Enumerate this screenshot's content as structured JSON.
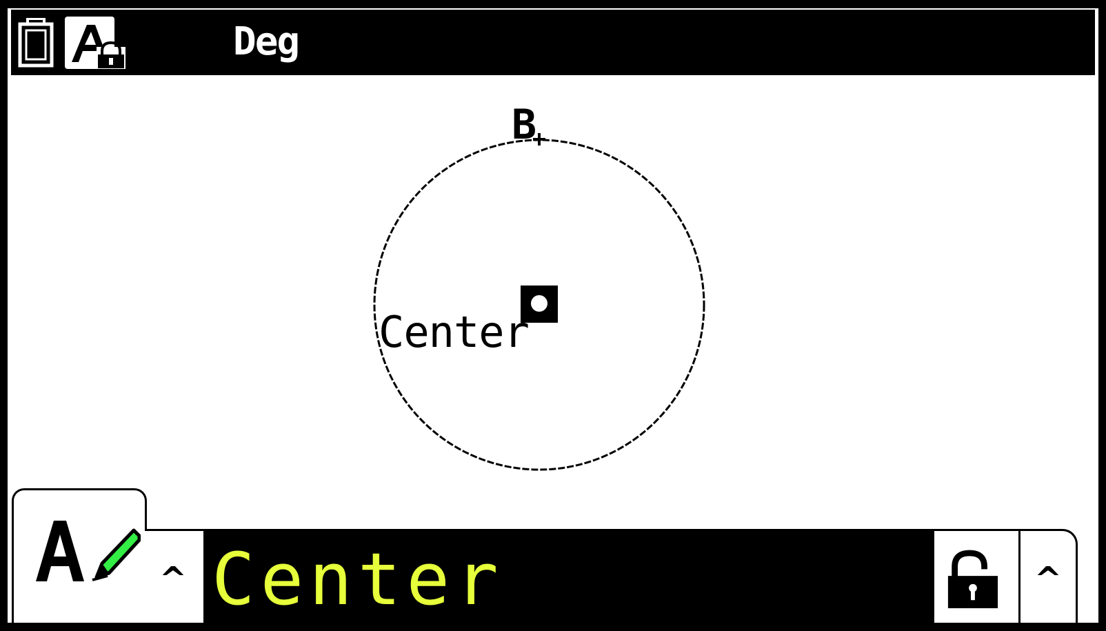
{
  "status_bar": {
    "battery_icon": "battery-icon",
    "input_mode_icon": "alpha-lock-icon",
    "angle_mode": "Deg"
  },
  "geometry": {
    "circle_label": "B",
    "center_label": "Center",
    "center_marker": "selected-point-marker"
  },
  "label_editor": {
    "mode_icon": "edit-label-icon",
    "up_left": "^",
    "value": "Center",
    "lock_icon": "unlocked-padlock-icon",
    "up_right": "^"
  },
  "colors": {
    "screen": "#000000",
    "lcd_background": "#ffffff",
    "label_text": "#e6ff3a",
    "pencil_accent": "#33ee44"
  }
}
